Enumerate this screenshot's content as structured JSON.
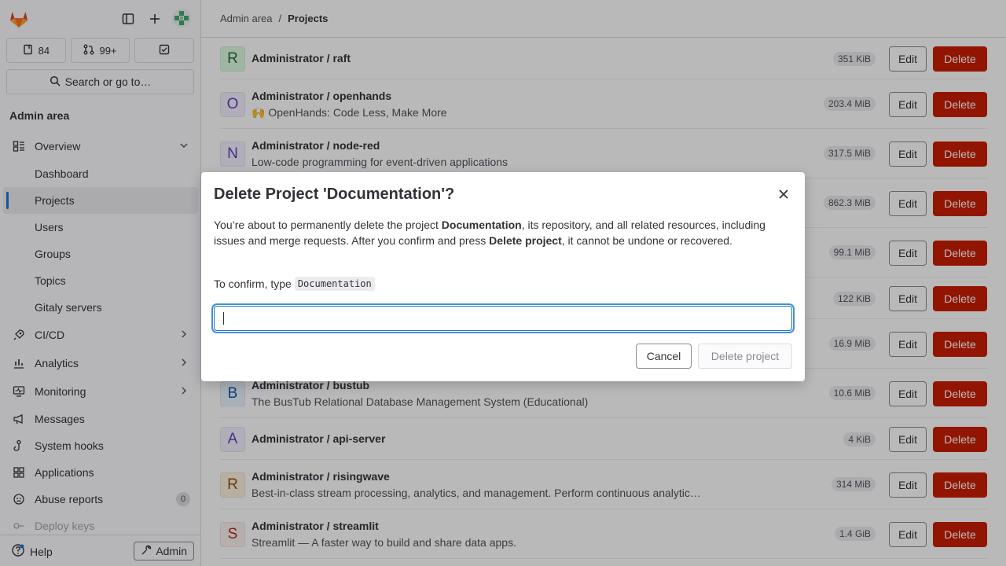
{
  "sidebar": {
    "counts": [
      {
        "icon": "issues-icon",
        "label": "84"
      },
      {
        "icon": "merge-request-icon",
        "label": "99+"
      },
      {
        "icon": "todo-icon",
        "label": ""
      }
    ],
    "search_label": "Search or go to…",
    "section_title": "Admin area",
    "nav": {
      "overview": "Overview",
      "dashboard": "Dashboard",
      "projects": "Projects",
      "users": "Users",
      "groups": "Groups",
      "topics": "Topics",
      "gitaly": "Gitaly servers",
      "cicd": "CI/CD",
      "analytics": "Analytics",
      "monitoring": "Monitoring",
      "messages": "Messages",
      "system_hooks": "System hooks",
      "applications": "Applications",
      "abuse_reports": "Abuse reports",
      "abuse_count": "0",
      "deploy_keys": "Deploy keys"
    },
    "help_label": "Help",
    "admin_label": "Admin"
  },
  "breadcrumb": {
    "root": "Admin area",
    "sep": "/",
    "current": "Projects"
  },
  "projects": [
    {
      "letter": "R",
      "name": "Administrator / raft",
      "desc": "",
      "size": "351 KiB",
      "bg": "#ddfbe2",
      "fg": "#24663b"
    },
    {
      "letter": "O",
      "name": "Administrator / openhands",
      "desc": "🙌 OpenHands: Code Less, Make More",
      "size": "203.4 MiB",
      "bg": "#f4f0ff",
      "fg": "#5943b6"
    },
    {
      "letter": "N",
      "name": "Administrator / node-red",
      "desc": "Low-code programming for event-driven applications",
      "size": "317.5 MiB",
      "bg": "#f4f0ff",
      "fg": "#5943b6"
    },
    {
      "letter": "",
      "name": "",
      "desc": "",
      "size": "862.3 MiB",
      "bg": "#fff",
      "fg": "#333"
    },
    {
      "letter": "",
      "name": "",
      "desc": "",
      "size": "99.1 MiB",
      "bg": "#fff",
      "fg": "#333"
    },
    {
      "letter": "",
      "name": "",
      "desc": "",
      "size": "122 KiB",
      "bg": "#fff",
      "fg": "#333"
    },
    {
      "letter": "",
      "name": "",
      "desc": "",
      "size": "16.9 MiB",
      "bg": "#fff",
      "fg": "#333"
    },
    {
      "letter": "B",
      "name": "Administrator / bustub",
      "desc": "The BusTub Relational Database Management System (Educational)",
      "size": "10.6 MiB",
      "bg": "#e9f3fc",
      "fg": "#0b5cad"
    },
    {
      "letter": "A",
      "name": "Administrator / api-server",
      "desc": "",
      "size": "4 KiB",
      "bg": "#f4f0ff",
      "fg": "#5943b6"
    },
    {
      "letter": "R",
      "name": "Administrator / risingwave",
      "desc": "Best-in-class stream processing, analytics, and management. Perform continuous analytic…",
      "size": "314 MiB",
      "bg": "#fdf1dd",
      "fg": "#8a5200"
    },
    {
      "letter": "S",
      "name": "Administrator / streamlit",
      "desc": "Streamlit — A faster way to build and share data apps.",
      "size": "1.4 GiB",
      "bg": "#fcf1ef",
      "fg": "#a2301c"
    }
  ],
  "row_actions": {
    "edit": "Edit",
    "delete": "Delete"
  },
  "modal": {
    "title": "Delete Project 'Documentation'?",
    "body_1": "You’re about to permanently delete the project ",
    "body_project": "Documentation",
    "body_2": ", its repository, and all related resources, including issues and merge requests. After you confirm and press ",
    "body_action": "Delete project",
    "body_3": ", it cannot be undone or recovered.",
    "confirm_prefix": "To confirm, type",
    "confirm_code": "Documentation",
    "input_value": "",
    "cancel": "Cancel",
    "delete_project": "Delete project"
  }
}
